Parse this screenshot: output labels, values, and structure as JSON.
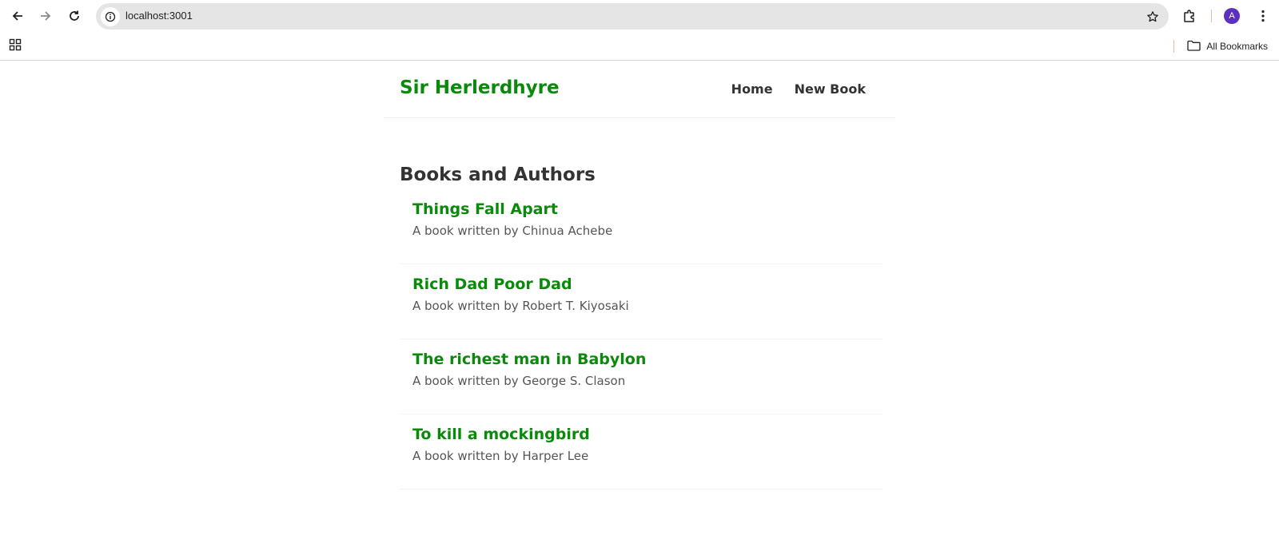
{
  "browser": {
    "url": "localhost:3001",
    "avatar_letter": "A",
    "bookmarks_label": "All Bookmarks"
  },
  "navbar": {
    "brand": "Sir Herlerdhyre",
    "links": [
      {
        "label": "Home"
      },
      {
        "label": "New Book"
      }
    ]
  },
  "main": {
    "heading": "Books and Authors",
    "books": [
      {
        "title": "Things Fall Apart",
        "description": "A book written by Chinua Achebe"
      },
      {
        "title": "Rich Dad Poor Dad",
        "description": "A book written by Robert T. Kiyosaki"
      },
      {
        "title": "The richest man in Babylon",
        "description": "A book written by George S. Clason"
      },
      {
        "title": "To kill a mockingbird",
        "description": "A book written by Harper Lee"
      }
    ]
  },
  "colors": {
    "brand_green": "#0a8a0a",
    "text_dark": "#333333",
    "avatar_purple": "#5b2fbf"
  }
}
